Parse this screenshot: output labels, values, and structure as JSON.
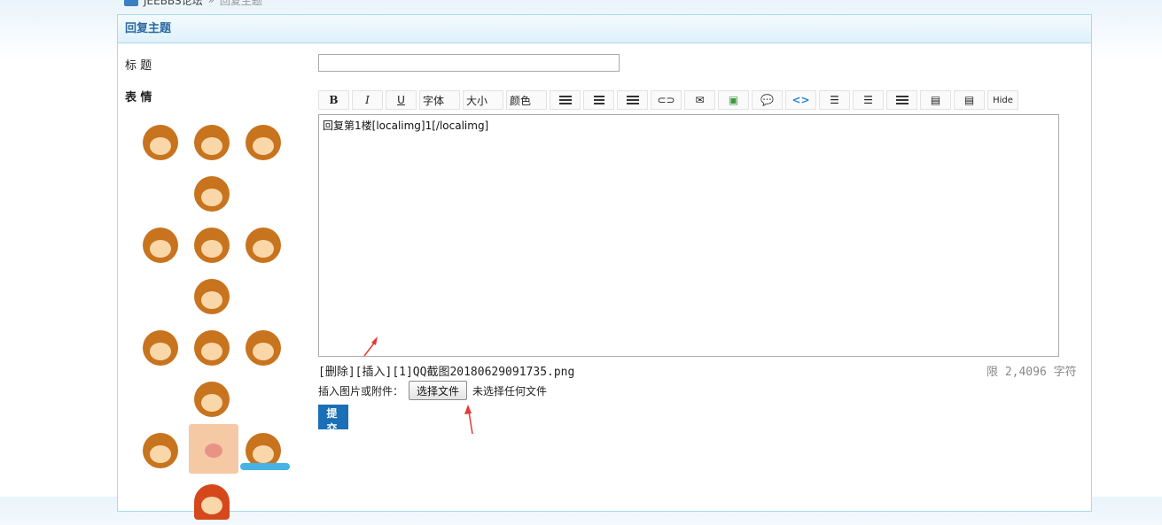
{
  "breadcrumb": {
    "site": "JEEBBS论坛",
    "sep": "»",
    "current": "回复主题"
  },
  "panel": {
    "title": "回复主题"
  },
  "form": {
    "title_label": "标 题",
    "title_value": "",
    "emotion_label": "表 情",
    "toolbar": {
      "font_label": "字体",
      "size_label": "大小",
      "color_label": "颜色",
      "hide_label": "Hide"
    },
    "content": "回复第1楼[localimg]1[/localimg]",
    "attachment": {
      "delete_label": "[删除]",
      "insert_label": "[插入]",
      "filename": "[1]QQ截图20180629091735.png"
    },
    "limit_text": "限 2,4096 字符",
    "file_row": {
      "label": "插入图片或附件：",
      "button": "选择文件",
      "status": "未选择任何文件"
    },
    "submit_label": "提 交"
  },
  "colors": {
    "accent": "#1a6fb7",
    "panel_border": "#a8d8f0",
    "header_text": "#2a6aa0",
    "arrow": "#e53935"
  }
}
